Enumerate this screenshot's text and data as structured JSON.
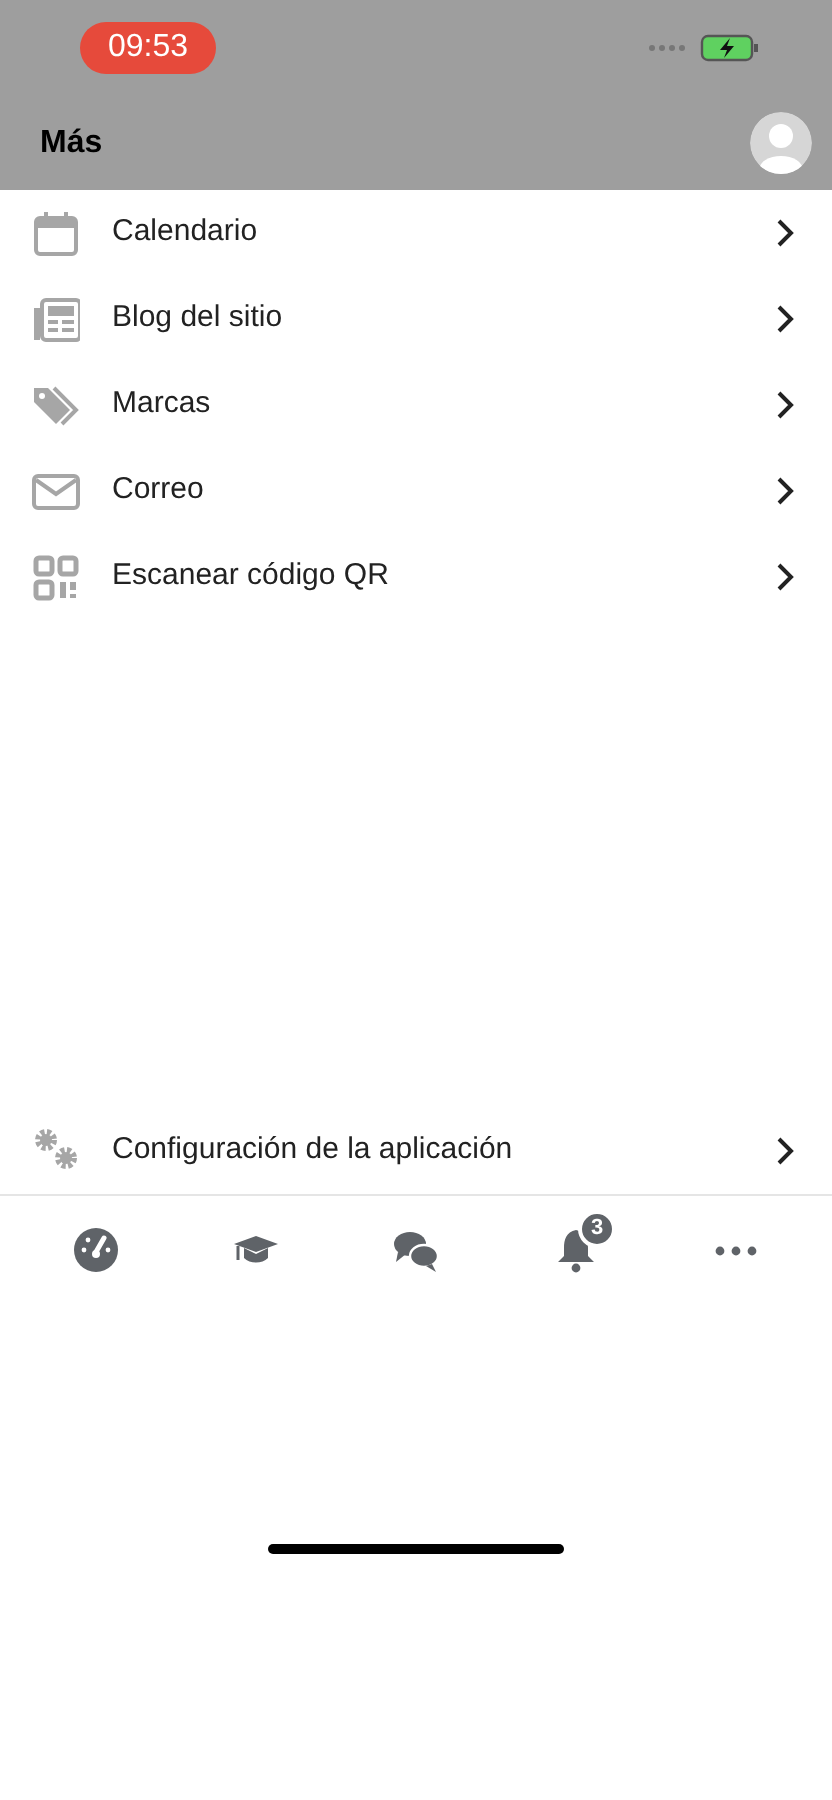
{
  "status_bar": {
    "time": "09:53"
  },
  "header": {
    "title": "Más"
  },
  "menu_items": [
    {
      "kind": "calendar",
      "label": "Calendario"
    },
    {
      "kind": "newspaper",
      "label": "Blog del sitio"
    },
    {
      "kind": "tags",
      "label": "Marcas"
    },
    {
      "kind": "mail",
      "label": "Correo"
    },
    {
      "kind": "qr",
      "label": "Escanear código QR"
    }
  ],
  "settings_item": {
    "kind": "gears",
    "label": "Configuración de la aplicación"
  },
  "tab_bar": [
    {
      "kind": "dashboard"
    },
    {
      "kind": "courses"
    },
    {
      "kind": "messages"
    },
    {
      "kind": "notifications",
      "badge": "3"
    },
    {
      "kind": "more"
    }
  ]
}
